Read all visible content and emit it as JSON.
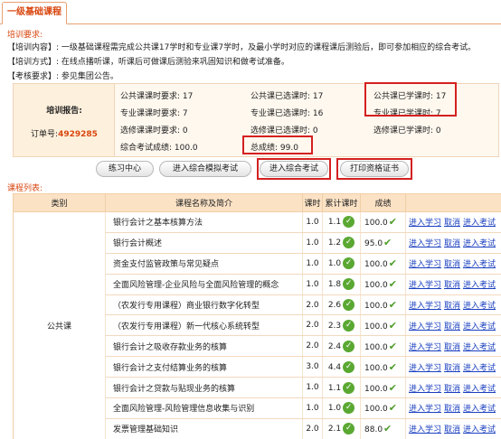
{
  "tab": {
    "label": "一级基础课程"
  },
  "requirements": {
    "title": "培训要求:",
    "lines": [
      {
        "key": "【培训内容】:",
        "text": "一级基础课程需完成公共课17学时和专业课7学时，及最小学时对应的课程课后测验后，即可参加相应的综合考试。"
      },
      {
        "key": "【培训方式】:",
        "text": "在线点播听课，听课后可做课后测验来巩固知识和做考试准备。"
      },
      {
        "key": "【考核要求】:",
        "text": "参见集团公告。"
      }
    ]
  },
  "report": {
    "title": "培训报告:",
    "order_label": "订单号:",
    "order_number": "4929285",
    "stats": {
      "public_required": "公共课课时要求: 17",
      "public_selected": "公共课已选课时: 17",
      "public_learned": "公共课已学课时: 17",
      "major_required": "专业课课时要求: 7",
      "major_selected": "专业课已选课时: 16",
      "major_learned": "专业课已学课时: 7",
      "elective_required": "选修课课时要求: 0",
      "elective_selected": "选修课已选课时: 0",
      "elective_learned": "选修课已学课时: 0",
      "exam_score": "综合考试成绩: 100.0",
      "total_score": "总成绩: 99.0"
    }
  },
  "buttons": {
    "practice": "练习中心",
    "mock_exam": "进入综合模拟考试",
    "exam": "进入综合考试",
    "print_cert": "打印资格证书"
  },
  "list": {
    "title": "课程列表:",
    "headers": [
      "类别",
      "课程名称及简介",
      "课时",
      "累计课时",
      "成绩",
      ""
    ],
    "category": "公共课",
    "ops": {
      "study": "进入学习",
      "cancel": "取消",
      "exam": "进入考试"
    },
    "rows": [
      {
        "name": "银行会计之基本核算方法",
        "hours": "1.0",
        "cumulative": "1.1",
        "score": "100.0"
      },
      {
        "name": "银行会计概述",
        "hours": "1.0",
        "cumulative": "1.2",
        "score": "95.0"
      },
      {
        "name": "资金支付监管政策与常见疑点",
        "hours": "1.0",
        "cumulative": "1.0",
        "score": "100.0"
      },
      {
        "name": "全面风险管理-企业风险与全面风险管理的概念",
        "hours": "1.0",
        "cumulative": "1.8",
        "score": "100.0"
      },
      {
        "name": "（农发行专用课程）商业银行数字化转型",
        "hours": "2.0",
        "cumulative": "2.6",
        "score": "100.0"
      },
      {
        "name": "（农发行专用课程）新一代核心系统转型",
        "hours": "2.0",
        "cumulative": "2.3",
        "score": "100.0"
      },
      {
        "name": "银行会计之吸收存款业务的核算",
        "hours": "2.0",
        "cumulative": "2.4",
        "score": "100.0"
      },
      {
        "name": "银行会计之支付结算业务的核算",
        "hours": "3.0",
        "cumulative": "4.4",
        "score": "100.0"
      },
      {
        "name": "银行会计之贷款与贴现业务的核算",
        "hours": "1.0",
        "cumulative": "1.1",
        "score": "100.0"
      },
      {
        "name": "全面风险管理-风险管理信息收集与识别",
        "hours": "1.0",
        "cumulative": "1.0",
        "score": "100.0"
      },
      {
        "name": "发票管理基础知识",
        "hours": "2.0",
        "cumulative": "2.1",
        "score": "88.0"
      }
    ]
  },
  "colors": {
    "accent": "#d9460f",
    "link": "#1a3fbf",
    "highlight_box": "#d42020",
    "check": "#5aa832"
  }
}
